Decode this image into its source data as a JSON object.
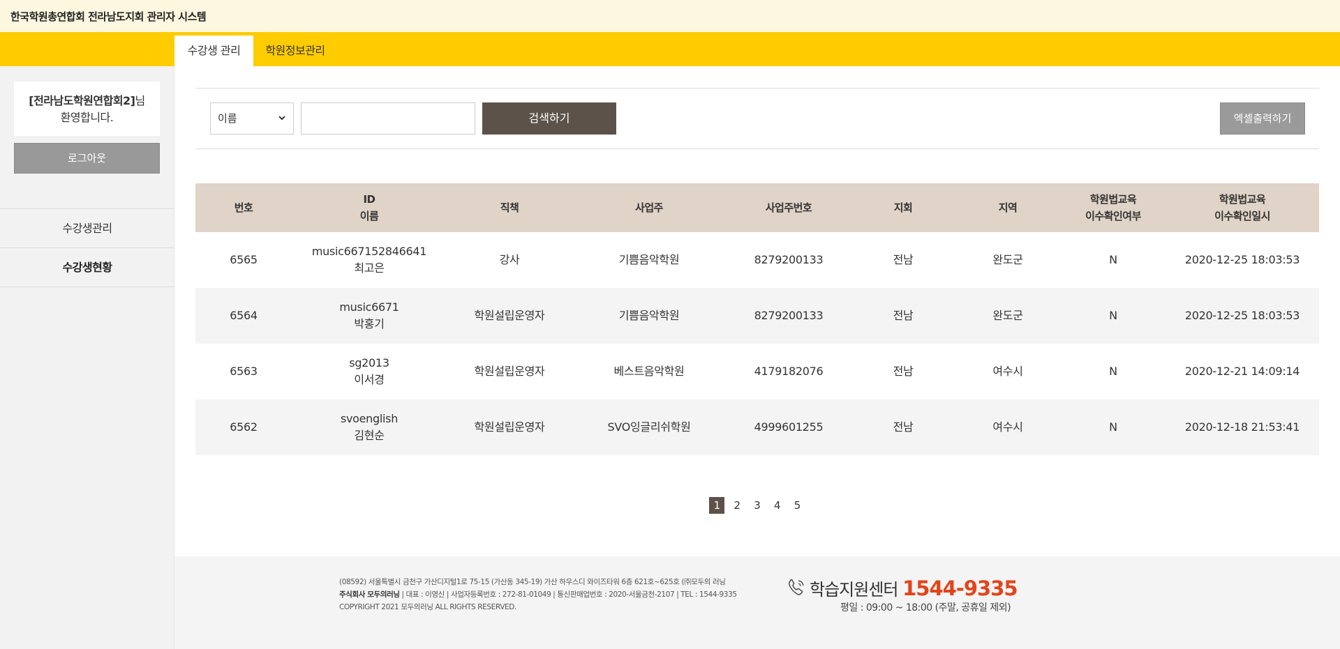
{
  "app": {
    "title": "한국학원총연합회 전라남도지회 관리자 시스템"
  },
  "tabs": [
    {
      "label": "수강생 관리",
      "active": true
    },
    {
      "label": "학원정보관리",
      "active": false
    }
  ],
  "sidebar": {
    "user_name": "[전라남도학원연합회2]",
    "user_suffix": "님",
    "welcome": "환영합니다.",
    "logout_label": "로그아웃",
    "menu": [
      {
        "label": "수강생관리",
        "active": false
      },
      {
        "label": "수강생현황",
        "active": true
      }
    ]
  },
  "search": {
    "field_selected": "이름",
    "query_value": "",
    "button_label": "검색하기",
    "excel_label": "엑셀출력하기"
  },
  "table": {
    "headers": [
      {
        "line1": "번호",
        "line2": ""
      },
      {
        "line1": "ID",
        "line2": "이름"
      },
      {
        "line1": "직책",
        "line2": ""
      },
      {
        "line1": "사업주",
        "line2": ""
      },
      {
        "line1": "사업주번호",
        "line2": ""
      },
      {
        "line1": "지회",
        "line2": ""
      },
      {
        "line1": "지역",
        "line2": ""
      },
      {
        "line1": "학원법교육",
        "line2": "이수확인여부"
      },
      {
        "line1": "학원법교육",
        "line2": "이수확인일시"
      }
    ],
    "rows": [
      {
        "no": "6565",
        "id": "music667152846641",
        "name": "최고은",
        "position": "강사",
        "business": "기쁨음악학원",
        "biz_no": "8279200133",
        "branch": "전남",
        "region": "완도군",
        "completed": "N",
        "completed_at": "2020-12-25 18:03:53"
      },
      {
        "no": "6564",
        "id": "music6671",
        "name": "박홍기",
        "position": "학원설립운영자",
        "business": "기쁨음악학원",
        "biz_no": "8279200133",
        "branch": "전남",
        "region": "완도군",
        "completed": "N",
        "completed_at": "2020-12-25 18:03:53"
      },
      {
        "no": "6563",
        "id": "sg2013",
        "name": "이서경",
        "position": "학원설립운영자",
        "business": "베스트음악학원",
        "biz_no": "4179182076",
        "branch": "전남",
        "region": "여수시",
        "completed": "N",
        "completed_at": "2020-12-21 14:09:14"
      },
      {
        "no": "6562",
        "id": "svoenglish",
        "name": "김현순",
        "position": "학원설립운영자",
        "business": "SVO잉글리쉬학원",
        "biz_no": "4999601255",
        "branch": "전남",
        "region": "여수시",
        "completed": "N",
        "completed_at": "2020-12-18 21:53:41"
      }
    ]
  },
  "pagination": {
    "pages": [
      "1",
      "2",
      "3",
      "4",
      "5"
    ],
    "current": "1"
  },
  "footer": {
    "address": "(08592) 서울특별시 금천구 가산디지털1로 75-15 (가산동 345-19) 가산 하우스디 와이즈타워 6층 621호~625호 (㈜모두의 러닝",
    "company": "주식회사 모두의러닝",
    "company_info": " | 대표 : 이영신 | 사업자등록번호 : 272-81-01049 | 통신판매업번호 : 2020-서울금천-2107 | TEL : 1544-9335",
    "copyright": "COPYRIGHT 2021 모두의러닝 ALL RIGHTS RESERVED.",
    "support_label": "학습지원센터",
    "support_number": "1544-9335",
    "support_hours": "평일 : 09:00 ~ 18:00 (주말, 공휴일 제외)"
  },
  "icons": {
    "phone": "phone-icon",
    "select_chevron": "chevron-down-icon"
  },
  "colors": {
    "brand_yellow": "#ffcc00",
    "header_bg": "#fdf7df",
    "table_header": "#e0d3c7",
    "button_dark": "#5c524a",
    "accent_red": "#e2441b"
  }
}
